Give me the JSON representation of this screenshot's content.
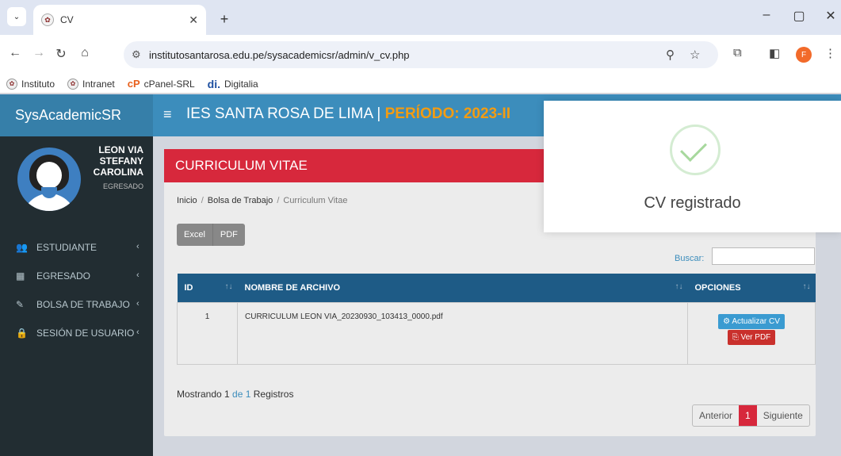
{
  "browser": {
    "tab_title": "CV",
    "url": "institutosantarosa.edu.pe/sysacademicsr/admin/v_cv.php",
    "profile_initial": "F",
    "bookmarks": [
      "Instituto",
      "Intranet",
      "cPanel-SRL",
      "Digitalia"
    ]
  },
  "app": {
    "brand": "SysAcademicSR",
    "institute": "IES SANTA ROSA DE LIMA | ",
    "period": "PERÍODO: 2023-II"
  },
  "user": {
    "name_line1": "LEON VIA",
    "name_line2": "STEFANY",
    "name_line3": "CAROLINA",
    "role": "EGRESADO"
  },
  "menu": [
    {
      "label": "ESTUDIANTE",
      "icon": "users-icon"
    },
    {
      "label": "EGRESADO",
      "icon": "graduation-icon"
    },
    {
      "label": "BOLSA DE TRABAJO",
      "icon": "edit-icon"
    },
    {
      "label": "SESIÓN DE USUARIO",
      "icon": "lock-icon"
    }
  ],
  "page": {
    "title": "CURRICULUM VITAE",
    "breadcrumb": [
      "Inicio",
      "Bolsa de Trabajo",
      "Curriculum Vitae"
    ],
    "export_buttons": [
      "Excel",
      "PDF"
    ],
    "search_label": "Buscar:",
    "table": {
      "columns": [
        "ID",
        "NOMBRE DE ARCHIVO",
        "OPCIONES"
      ],
      "rows": [
        {
          "id": "1",
          "file": "CURRICULUM LEON VIA_20230930_103413_0000.pdf",
          "btn_update": "Actualizar CV",
          "btn_pdf": "Ver PDF"
        }
      ]
    },
    "info": {
      "prefix": "Mostrando ",
      "from": "1",
      "mid": " de ",
      "total": "1",
      "suffix": " Registros"
    },
    "pager": {
      "prev": "Anterior",
      "current": "1",
      "next": "Siguiente"
    }
  },
  "toast": {
    "message": "CV registrado",
    "colors": {
      "success": "#a7d89d"
    }
  },
  "colors": {
    "sidebar": "#222d32",
    "header": "#3c8dbc",
    "accent_red": "#d7283c",
    "period": "#f39c12"
  }
}
